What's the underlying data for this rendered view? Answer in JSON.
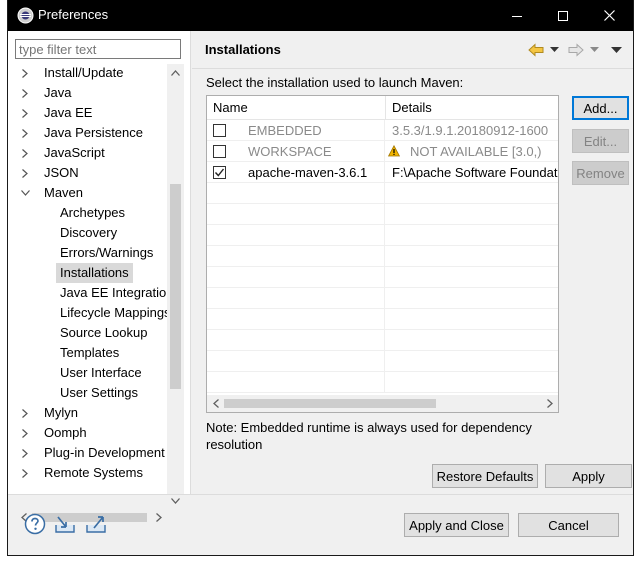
{
  "window": {
    "title": "Preferences"
  },
  "filter": {
    "placeholder": "type filter text"
  },
  "tree": {
    "items": [
      {
        "label": "Install/Update",
        "level": 0,
        "expand": "collapsed"
      },
      {
        "label": "Java",
        "level": 0,
        "expand": "collapsed"
      },
      {
        "label": "Java EE",
        "level": 0,
        "expand": "collapsed"
      },
      {
        "label": "Java Persistence",
        "level": 0,
        "expand": "collapsed"
      },
      {
        "label": "JavaScript",
        "level": 0,
        "expand": "collapsed"
      },
      {
        "label": "JSON",
        "level": 0,
        "expand": "collapsed"
      },
      {
        "label": "Maven",
        "level": 0,
        "expand": "expanded"
      },
      {
        "label": "Archetypes",
        "level": 1,
        "expand": "none"
      },
      {
        "label": "Discovery",
        "level": 1,
        "expand": "none"
      },
      {
        "label": "Errors/Warnings",
        "level": 1,
        "expand": "none"
      },
      {
        "label": "Installations",
        "level": 1,
        "expand": "none",
        "selected": true
      },
      {
        "label": "Java EE Integration",
        "level": 1,
        "expand": "none"
      },
      {
        "label": "Lifecycle Mappings",
        "level": 1,
        "expand": "none"
      },
      {
        "label": "Source Lookup",
        "level": 1,
        "expand": "none"
      },
      {
        "label": "Templates",
        "level": 1,
        "expand": "none"
      },
      {
        "label": "User Interface",
        "level": 1,
        "expand": "none"
      },
      {
        "label": "User Settings",
        "level": 1,
        "expand": "none"
      },
      {
        "label": "Mylyn",
        "level": 0,
        "expand": "collapsed"
      },
      {
        "label": "Oomph",
        "level": 0,
        "expand": "collapsed"
      },
      {
        "label": "Plug-in Development",
        "level": 0,
        "expand": "collapsed"
      },
      {
        "label": "Remote Systems",
        "level": 0,
        "expand": "collapsed"
      }
    ]
  },
  "page": {
    "title": "Installations",
    "instruction": "Select the installation used to launch Maven:",
    "note": "Note: Embedded runtime is always used for dependency resolution"
  },
  "table": {
    "columns": [
      "Name",
      "Details"
    ],
    "rows": [
      {
        "checked": false,
        "name": "EMBEDDED",
        "details": "3.5.3/1.9.1.20180912-1600",
        "muted": true,
        "warning": false
      },
      {
        "checked": false,
        "name": "WORKSPACE",
        "details": "NOT AVAILABLE [3.0,)",
        "muted": true,
        "warning": true
      },
      {
        "checked": true,
        "name": "apache-maven-3.6.1",
        "details": "F:\\Apache Software Foundati",
        "muted": false,
        "warning": false
      }
    ]
  },
  "buttons": {
    "add": "Add...",
    "edit": "Edit...",
    "remove": "Remove",
    "restore_defaults": "Restore Defaults",
    "apply": "Apply",
    "apply_close": "Apply and Close",
    "cancel": "Cancel"
  },
  "colors": {
    "titlebar": "#000000",
    "accent": "#0078d7",
    "warning": "#f0b400",
    "nav_arrow": "#e6b020"
  },
  "icons": {
    "app": "eclipse-icon",
    "minimize": "minimize-icon",
    "maximize": "maximize-icon",
    "close": "close-icon",
    "back": "back-arrow-icon",
    "forward": "forward-arrow-icon",
    "menu": "view-menu-icon",
    "help": "help-icon",
    "import": "import-icon",
    "export": "export-icon",
    "warning": "warning-icon"
  }
}
